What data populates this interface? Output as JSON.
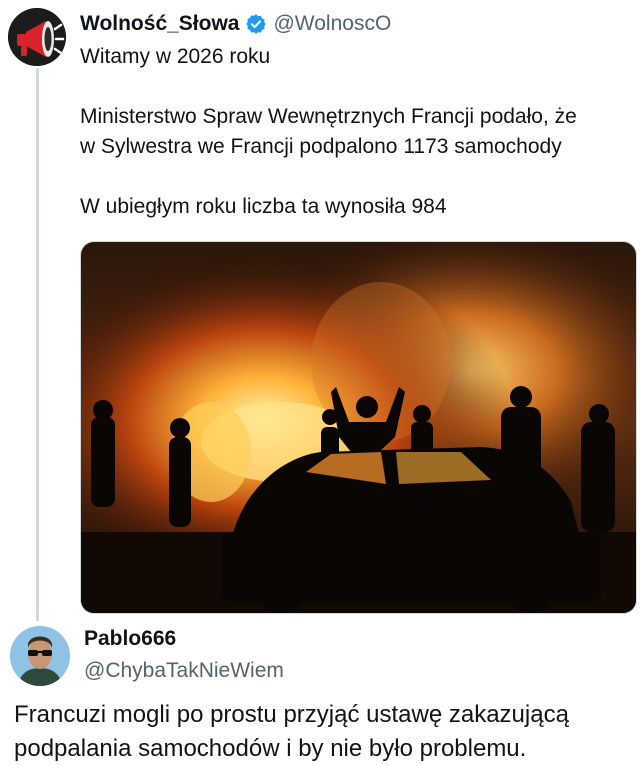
{
  "tweet": {
    "author_name": "Wolność_Słowa",
    "author_handle": "@WolnoscO",
    "lines": [
      "Witamy w 2026 roku",
      "Ministerstwo Spraw Wewnętrznych Francji podało, że",
      "w Sylwestra we Francji podpalono 1173 samochody",
      "W ubiegłym roku liczba ta wynosiła 984"
    ],
    "verified_color": "#1d9bf0",
    "avatar_icon": "megaphone-icon",
    "media_icon": "burning-car-photo"
  },
  "reply": {
    "author_name": "Pablo666",
    "author_handle": "@ChybaTakNieWiem",
    "lines": [
      "Francuzi mogli po prostu przyjąć ustawę zakazującą",
      "podpalania samochodów i by nie było problemu."
    ],
    "avatar_icon": "user-with-sunglasses-avatar"
  }
}
